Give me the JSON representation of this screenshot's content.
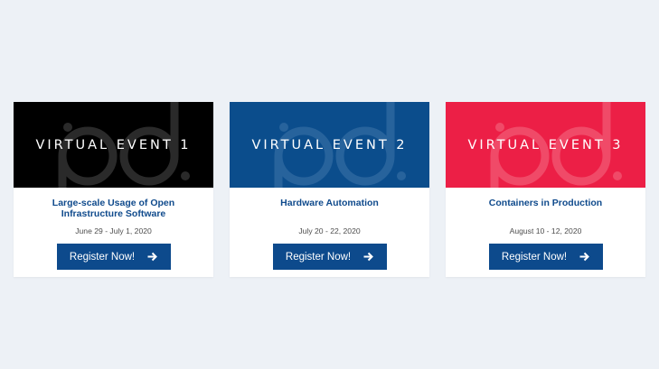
{
  "events": [
    {
      "banner_label": "VIRTUAL EVENT 1",
      "banner_color": "#000000",
      "watermark_color": "#2a2a2a",
      "title": "Large-scale Usage of Open Infrastructure Software",
      "dates": "June 29 - July 1, 2020",
      "button_label": "Register Now!",
      "button_icon": "arrow-right-icon"
    },
    {
      "banner_label": "VIRTUAL EVENT 2",
      "banner_color": "#0b4d8c",
      "watermark_color": "#27639c",
      "title": "Hardware Automation",
      "dates": "July 20 - 22, 2020",
      "button_label": "Register Now!",
      "button_icon": "arrow-right-icon"
    },
    {
      "banner_label": "VIRTUAL EVENT 3",
      "banner_color": "#ec1f46",
      "watermark_color": "#f04a68",
      "title": "Containers in Production",
      "dates": "August 10 - 12, 2020",
      "button_label": "Register Now!",
      "button_icon": "arrow-right-icon"
    }
  ],
  "colors": {
    "page_background": "#edf1f6",
    "title_blue": "#0f4a8c",
    "button_blue": "#0d4a8c"
  }
}
